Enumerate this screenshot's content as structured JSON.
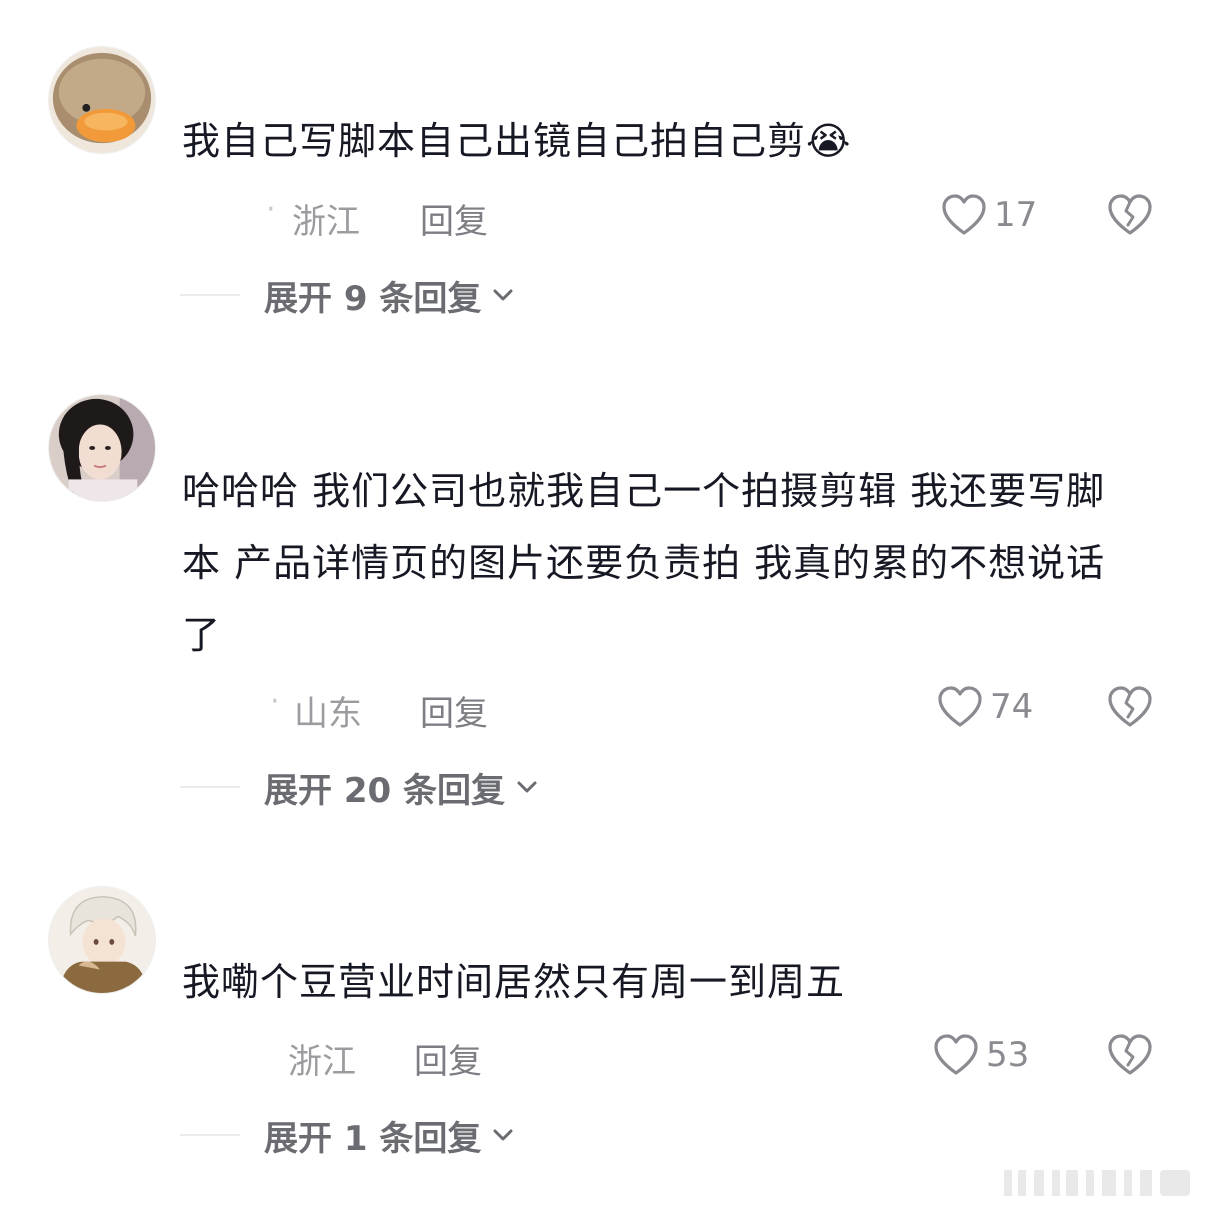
{
  "comments": [
    {
      "username": "",
      "text": "我自己写脚本自己出镜自己拍自己剪😭",
      "location": "浙江",
      "reply_label": "回复",
      "likes": "17",
      "expand_label": "展开 9 条回复"
    },
    {
      "username": "",
      "text": "哈哈哈 我们公司也就我自己一个拍摄剪辑 我还要写脚本 产品详情页的图片还要负责拍 我真的累的不想说话了",
      "location": "山东",
      "reply_label": "回复",
      "likes": "74",
      "expand_label": "展开 20 条回复"
    },
    {
      "username": "",
      "text": "我嘞个豆营业时间居然只有周一到周五",
      "location": "浙江",
      "reply_label": "回复",
      "likes": "53",
      "expand_label": "展开 1 条回复"
    }
  ],
  "icons": {
    "like": "heart-outline-icon",
    "dislike": "broken-heart-icon",
    "expand": "chevron-down-icon"
  },
  "colors": {
    "text": "#161823",
    "secondary": "#9b9ca0",
    "expand_text": "#6b6c72"
  }
}
